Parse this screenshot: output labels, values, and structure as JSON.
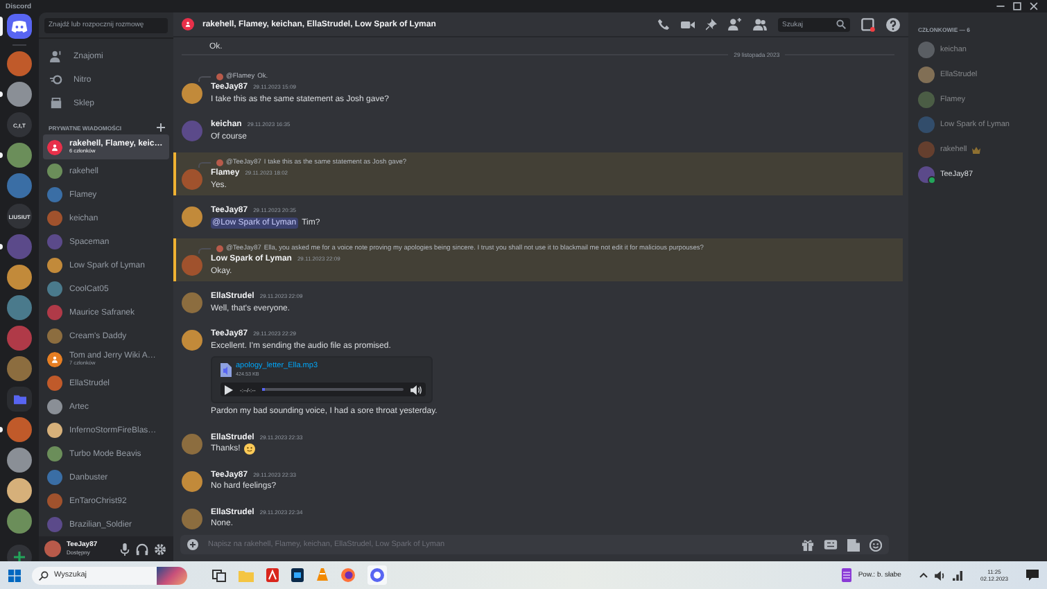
{
  "window": {
    "title": "Discord"
  },
  "servers": [
    {
      "kind": "home",
      "selected": true
    },
    {
      "kind": "image",
      "selected": false,
      "unread": false
    },
    {
      "kind": "image",
      "selected": false,
      "unread": true
    },
    {
      "kind": "text",
      "label": "C,t,T",
      "selected": false,
      "unread": false
    },
    {
      "kind": "image",
      "selected": false,
      "unread": true
    },
    {
      "kind": "image",
      "selected": false,
      "unread": false
    },
    {
      "kind": "text",
      "label": "LIUSIUT",
      "selected": false,
      "unread": false
    },
    {
      "kind": "image",
      "selected": false,
      "unread": true
    },
    {
      "kind": "image",
      "selected": false,
      "unread": false
    },
    {
      "kind": "image",
      "selected": false,
      "unread": false
    },
    {
      "kind": "image",
      "selected": false,
      "unread": false
    },
    {
      "kind": "image",
      "selected": false,
      "unread": false
    },
    {
      "kind": "folder",
      "selected": false,
      "unread": false
    },
    {
      "kind": "image",
      "selected": false,
      "unread": true
    },
    {
      "kind": "image",
      "selected": false,
      "unread": false
    },
    {
      "kind": "image",
      "selected": false,
      "unread": false
    },
    {
      "kind": "image",
      "selected": false,
      "unread": false
    }
  ],
  "dm": {
    "search_placeholder": "Znajdź lub rozpocznij rozmowę",
    "nav": [
      {
        "kind": "friends",
        "label": "Znajomi"
      },
      {
        "kind": "nitro",
        "label": "Nitro"
      },
      {
        "kind": "shop",
        "label": "Sklep"
      }
    ],
    "section_title": "PRYWATNE WIADOMOŚCI",
    "conversations": [
      {
        "kind": "group",
        "name": "rakehell, Flamey, keic…",
        "subtitle": "6 członków",
        "selected": true
      },
      {
        "kind": "user",
        "name": "rakehell",
        "selected": false
      },
      {
        "kind": "user",
        "name": "Flamey",
        "selected": false
      },
      {
        "kind": "user",
        "name": "keichan",
        "selected": false
      },
      {
        "kind": "user",
        "name": "Spaceman",
        "selected": false
      },
      {
        "kind": "user",
        "name": "Low Spark of Lyman",
        "selected": false
      },
      {
        "kind": "user",
        "name": "CoolCat05",
        "selected": false
      },
      {
        "kind": "user",
        "name": "Maurice Safranek",
        "selected": false
      },
      {
        "kind": "user",
        "name": "Cream's Daddy",
        "selected": false
      },
      {
        "kind": "group",
        "name": "Tom and Jerry Wiki A…",
        "subtitle": "7 członków",
        "selected": false
      },
      {
        "kind": "user",
        "name": "EllaStrudel",
        "selected": false
      },
      {
        "kind": "user",
        "name": "Artec",
        "selected": false
      },
      {
        "kind": "user",
        "name": "InfernoStormFireBlas…",
        "selected": false
      },
      {
        "kind": "user",
        "name": "Turbo Mode Beavis",
        "selected": false
      },
      {
        "kind": "user",
        "name": "Danbuster",
        "selected": false
      },
      {
        "kind": "user",
        "name": "EnTaroChrist92",
        "selected": false
      },
      {
        "kind": "user",
        "name": "Brazilian_Soldier",
        "selected": false
      }
    ],
    "user": {
      "name": "TeeJay87",
      "status": "Dostępny"
    }
  },
  "chat": {
    "title": "rakehell, Flamey, keichan, EllaStrudel, Low Spark of Lyman",
    "search_placeholder": "Szukaj",
    "timeline": [
      {
        "kind": "fragment",
        "text": "Ok."
      },
      {
        "kind": "divider",
        "label": "29 listopada 2023"
      },
      {
        "kind": "message",
        "author": "TeeJay87",
        "time": "29.11.2023 15:09",
        "text": "I take this as the same statement as Josh gave?",
        "highlighted": false,
        "reply": {
          "author": "@Flamey",
          "text": "Ok."
        }
      },
      {
        "kind": "message",
        "author": "keichan",
        "time": "29.11.2023 16:35",
        "text": "Of course",
        "highlighted": false
      },
      {
        "kind": "message",
        "author": "Flamey",
        "time": "29.11.2023 18:02",
        "text": "Yes.",
        "highlighted": true,
        "reply": {
          "author": "@TeeJay87",
          "text": "I take this as the same statement as Josh gave?"
        }
      },
      {
        "kind": "message",
        "author": "TeeJay87",
        "time": "29.11.2023 20:35",
        "mention": "@Low Spark of Lyman",
        "text": "Tim?",
        "highlighted": false
      },
      {
        "kind": "message",
        "author": "Low Spark of Lyman",
        "time": "29.11.2023 22:09",
        "text": "Okay.",
        "highlighted": true,
        "reply": {
          "author": "@TeeJay87",
          "text": "Ella, you asked me for a voice note proving my apologies being sincere. I trust you shall not use it to blackmail me not edit it for malicious purpouses?"
        }
      },
      {
        "kind": "message",
        "author": "EllaStrudel",
        "time": "29.11.2023 22:09",
        "text": "Well, that's everyone.",
        "highlighted": false
      },
      {
        "kind": "message",
        "author": "TeeJay87",
        "time": "29.11.2023 22:29",
        "text": "Excellent. I'm sending the audio file as promised.",
        "highlighted": false,
        "attachment": {
          "file_name": "apology_letter_Ella.mp3",
          "size": "424.53 KB",
          "time": "-:--/-:--",
          "level": 0.02
        },
        "text_after": "Pardon my bad sounding voice, I had a sore throat yesterday."
      },
      {
        "kind": "message",
        "author": "EllaStrudel",
        "time": "29.11.2023 22:33",
        "text": "Thanks!",
        "emoji": true,
        "highlighted": false
      },
      {
        "kind": "message",
        "author": "TeeJay87",
        "time": "29.11.2023 22:33",
        "text": "No hard feelings?",
        "highlighted": false
      },
      {
        "kind": "message",
        "author": "EllaStrudel",
        "time": "29.11.2023 22:34",
        "text": "None.",
        "highlighted": false
      }
    ],
    "composer_placeholder": "Napisz na rakehell, Flamey, keichan, EllaStrudel, Low Spark of Lyman"
  },
  "members": {
    "title": "CZŁONKOWIE — 6",
    "items": [
      {
        "name": "keichan",
        "online": false,
        "owner": false
      },
      {
        "name": "EllaStrudel",
        "online": false,
        "owner": false
      },
      {
        "name": "Flamey",
        "online": false,
        "owner": false
      },
      {
        "name": "Low Spark of Lyman",
        "online": false,
        "owner": false
      },
      {
        "name": "rakehell",
        "online": false,
        "owner": true
      },
      {
        "name": "TeeJay87",
        "online": true,
        "owner": false
      }
    ]
  },
  "taskbar": {
    "search_placeholder": "Wyszukaj",
    "weather": "Pow.: b. słabe",
    "time": "11:25",
    "date": "02.12.2023"
  }
}
